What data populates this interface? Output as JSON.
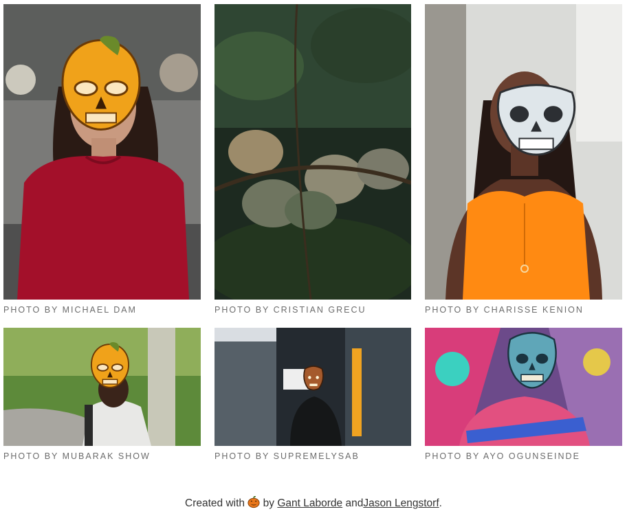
{
  "photos": [
    {
      "caption": "PHOTO BY MICHAEL DAM",
      "mask": "pumpkin-skull-mask-icon",
      "subject": "person-red-top"
    },
    {
      "caption": "PHOTO BY CRISTIAN GRECU",
      "mask": "none",
      "subject": "skulls-in-foliage"
    },
    {
      "caption": "PHOTO BY CHARISSE KENION",
      "mask": "white-skull-mask-icon",
      "subject": "person-orange-top"
    },
    {
      "caption": "PHOTO BY MUBARAK SHOW",
      "mask": "pumpkin-skull-mask-icon",
      "subject": "person-park"
    },
    {
      "caption": "PHOTO BY SUPREMELYSAB",
      "mask": "werewolf-mask-icon",
      "subject": "person-shipping-container"
    },
    {
      "caption": "PHOTO BY AYO OGUNSEINDE",
      "mask": "zombie-mask-icon",
      "subject": "person-graffiti"
    }
  ],
  "footer": {
    "prefix": "Created with",
    "icon": "jack-o-lantern-icon",
    "by": "by",
    "author1": "Gant Laborde",
    "and": "and",
    "author2": "Jason Lengstorf",
    "suffix": "."
  },
  "colors": {
    "caption": "#6b6b6b",
    "pumpkin": "#f0a21a",
    "red_top": "#a3102a",
    "orange_top": "#ff8a12",
    "zombie": "#5fa6b8"
  }
}
